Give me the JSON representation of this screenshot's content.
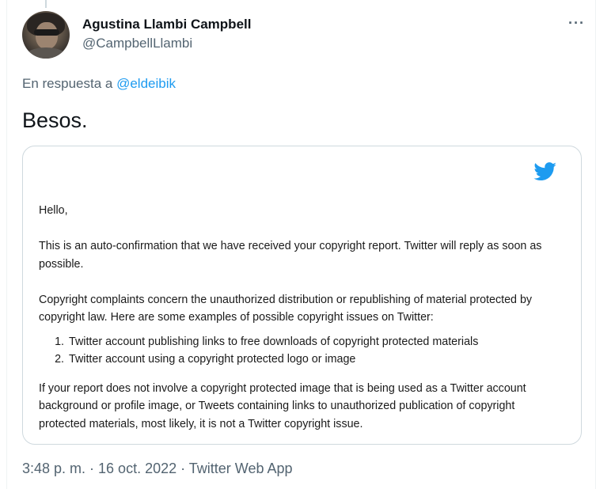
{
  "tweet": {
    "author": {
      "display_name": "Agustina Llambi Campbell",
      "handle": "@CampbellLlambi"
    },
    "more_icon": "more-horizontal-icon",
    "reply_prefix": "En respuesta a",
    "reply_mention": "@eldeibik",
    "text": "Besos.",
    "meta": "3:48 p. m. · 16 oct. 2022 · Twitter Web App"
  },
  "media": {
    "logo_icon": "twitter-bird-icon",
    "brand_color": "#1d9bf0",
    "greeting": "Hello,",
    "para1": "This is an auto-confirmation that we have received your copyright report. Twitter will reply as soon as possible.",
    "para2": "Copyright complaints concern the unauthorized distribution or republishing of material protected by copyright law. Here are some examples of possible copyright issues on Twitter:",
    "list": [
      "Twitter account publishing links to free downloads of copyright protected materials",
      "Twitter account using a copyright protected logo or image"
    ],
    "para3": "If your report does not involve a copyright protected image that is being used as a Twitter account background or profile image, or Tweets containing links to unauthorized publication of copyright protected materials, most likely, it is not a Twitter copyright issue."
  }
}
